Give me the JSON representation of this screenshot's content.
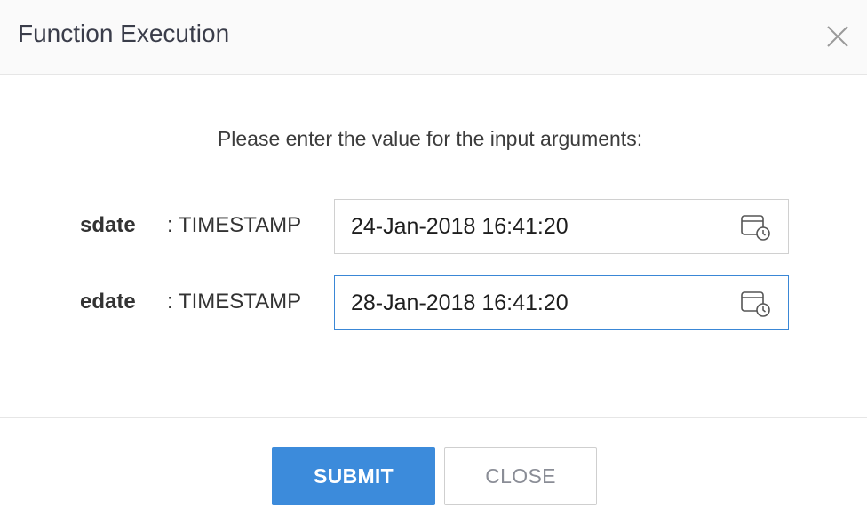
{
  "dialog": {
    "title": "Function Execution",
    "close_icon": "close-icon"
  },
  "instructions": "Please enter the value for the input arguments:",
  "arguments": [
    {
      "name": "sdate",
      "type": ": TIMESTAMP",
      "value": "24-Jan-2018 16:41:20",
      "icon": "calendar-clock-icon",
      "focused": false
    },
    {
      "name": "edate",
      "type": ": TIMESTAMP",
      "value": "28-Jan-2018 16:41:20",
      "icon": "calendar-clock-icon",
      "focused": true
    }
  ],
  "buttons": {
    "submit_label": "SUBMIT",
    "close_label": "CLOSE"
  },
  "colors": {
    "accent": "#3c8bdb",
    "focus_border": "#3a87d6",
    "header_bg": "#fafafa"
  }
}
